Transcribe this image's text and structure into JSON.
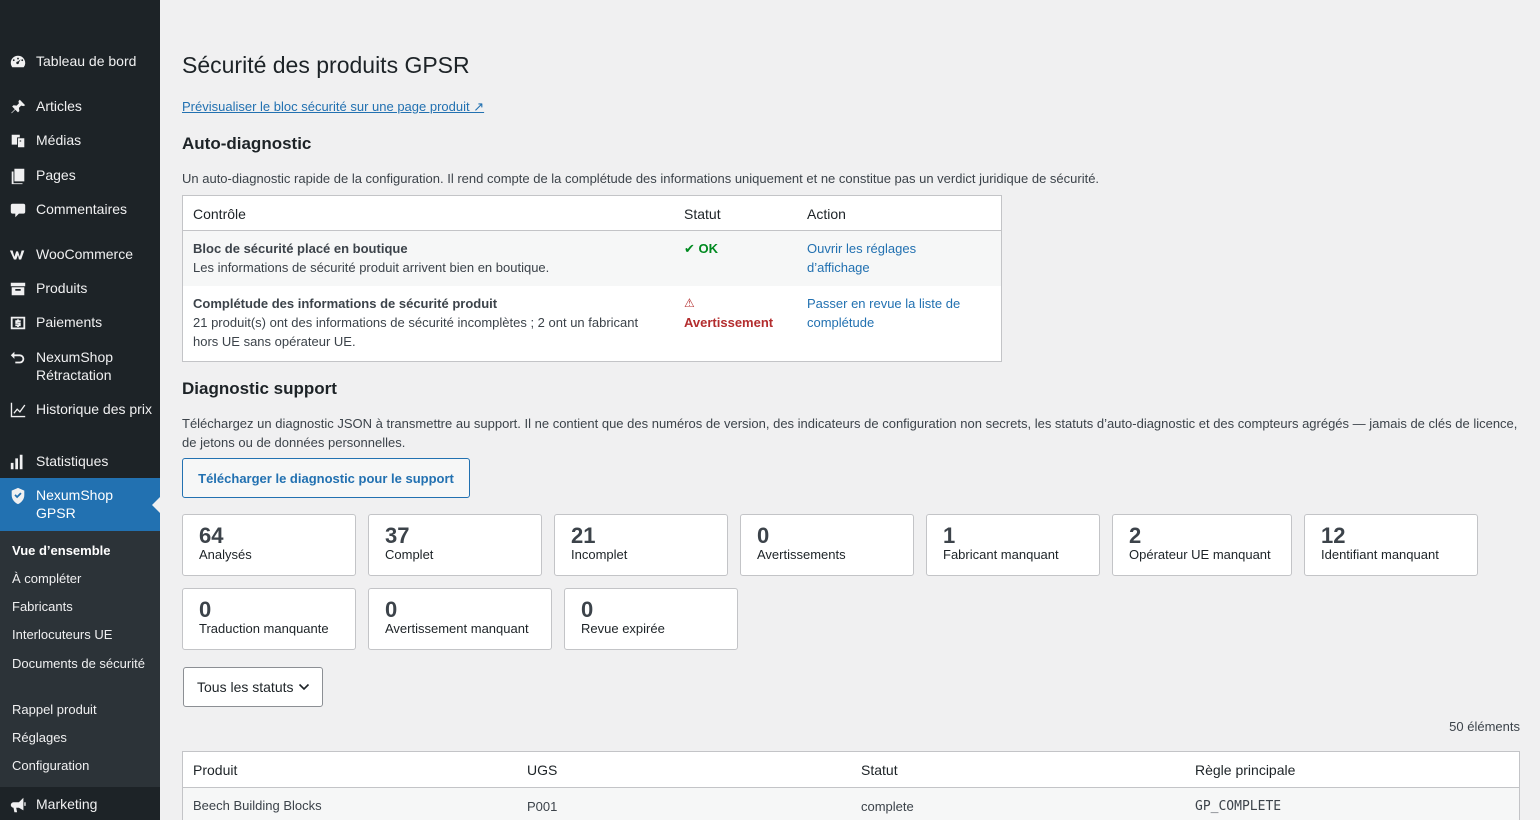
{
  "sidebar": {
    "items": [
      {
        "label": "Tableau de bord",
        "icon": "dashboard-icon"
      },
      {
        "label": "Articles",
        "icon": "pin-icon"
      },
      {
        "label": "Médias",
        "icon": "media-icon"
      },
      {
        "label": "Pages",
        "icon": "pages-icon"
      },
      {
        "label": "Commentaires",
        "icon": "comments-icon"
      },
      {
        "label": "WooCommerce",
        "icon": "woocommerce-icon"
      },
      {
        "label": "Produits",
        "icon": "archive-icon"
      },
      {
        "label": "Paiements",
        "icon": "payments-icon"
      },
      {
        "label": "NexumShop Rétractation",
        "icon": "undo-icon"
      },
      {
        "label": "Historique des prix",
        "icon": "chart-line-icon"
      },
      {
        "label": "Statistiques",
        "icon": "chart-bar-icon"
      },
      {
        "label": "NexumShop GPSR",
        "icon": "shield-icon",
        "active": true
      },
      {
        "label": "Marketing",
        "icon": "megaphone-icon"
      }
    ],
    "submenu": [
      {
        "label": "Vue d’ensemble",
        "current": true
      },
      {
        "label": "À compléter"
      },
      {
        "label": "Fabricants"
      },
      {
        "label": "Interlocuteurs UE"
      },
      {
        "label": "Documents de sécurité"
      },
      {
        "label": "Rappel produit"
      },
      {
        "label": "Réglages"
      },
      {
        "label": "Configuration"
      }
    ]
  },
  "page": {
    "title": "Sécurité des produits GPSR",
    "preview_link": "Prévisualiser le bloc sécurité sur une page produit ↗"
  },
  "auto_diagnostic": {
    "heading": "Auto-diagnostic",
    "description": "Un auto-diagnostic rapide de la configuration. Il rend compte de la complétude des informations uniquement et ne constitue pas un verdict juridique de sécurité.",
    "columns": [
      "Contrôle",
      "Statut",
      "Action"
    ],
    "rows": [
      {
        "title": "Bloc de sécurité placé en boutique",
        "detail": "Les informations de sécurité produit arrivent bien en boutique.",
        "status_icon": "✔",
        "status": "OK",
        "action": "Ouvrir les réglages d’affichage"
      },
      {
        "title": "Complétude des informations de sécurité produit",
        "detail": "21 produit(s) ont des informations de sécurité incomplètes ; 2 ont un fabricant hors UE sans opérateur UE.",
        "status_icon": "⚠",
        "status": "Avertissement",
        "action": "Passer en revue la liste de complétude"
      }
    ]
  },
  "support": {
    "heading": "Diagnostic support",
    "description": "Téléchargez un diagnostic JSON à transmettre au support. Il ne contient que des numéros de version, des indicateurs de configuration non secrets, les statuts d’auto-diagnostic et des compteurs agrégés — jamais de clés de licence, de jetons ou de données personnelles.",
    "button": "Télécharger le diagnostic pour le support"
  },
  "stats": [
    {
      "value": "64",
      "label": "Analysés"
    },
    {
      "value": "37",
      "label": "Complet"
    },
    {
      "value": "21",
      "label": "Incomplet"
    },
    {
      "value": "0",
      "label": "Avertissements"
    },
    {
      "value": "1",
      "label": "Fabricant manquant"
    },
    {
      "value": "2",
      "label": "Opérateur UE manquant"
    },
    {
      "value": "12",
      "label": "Identifiant manquant"
    },
    {
      "value": "0",
      "label": "Traduction manquante"
    },
    {
      "value": "0",
      "label": "Avertissement manquant"
    },
    {
      "value": "0",
      "label": "Revue expirée"
    }
  ],
  "filter": {
    "selected": "Tous les statuts"
  },
  "items_count": "50 éléments",
  "products": {
    "columns": [
      "Produit",
      "UGS",
      "Statut",
      "Règle principale"
    ],
    "rows": [
      {
        "product": "Beech Building Blocks",
        "sku": "P001",
        "status": "complete",
        "rule": "GP_COMPLETE"
      }
    ]
  },
  "colors": {
    "accent": "#2271b1",
    "sidebar": "#1d2327",
    "ok": "#008a20",
    "warning": "#b32d2e"
  }
}
